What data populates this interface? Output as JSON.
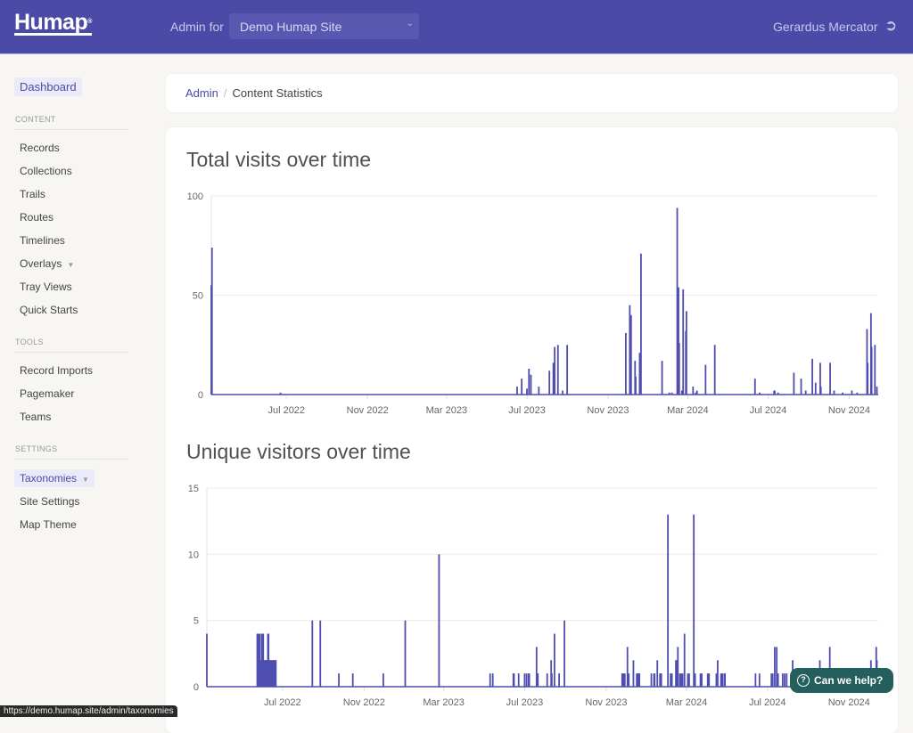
{
  "header": {
    "logo": "Humap",
    "admin_for": "Admin for",
    "site": "Demo Humap Site",
    "user": "Gerardus Mercator",
    "logout_icon": "sign-out-icon"
  },
  "sidebar": {
    "dashboard": "Dashboard",
    "sections": [
      {
        "title": "CONTENT",
        "items": [
          {
            "label": "Records"
          },
          {
            "label": "Collections"
          },
          {
            "label": "Trails"
          },
          {
            "label": "Routes"
          },
          {
            "label": "Timelines"
          },
          {
            "label": "Overlays",
            "caret": true
          },
          {
            "label": "Tray Views"
          },
          {
            "label": "Quick Starts"
          }
        ]
      },
      {
        "title": "TOOLS",
        "items": [
          {
            "label": "Record Imports"
          },
          {
            "label": "Pagemaker"
          },
          {
            "label": "Teams"
          }
        ]
      },
      {
        "title": "SETTINGS",
        "items": [
          {
            "label": "Taxonomies",
            "caret": true,
            "active": true
          },
          {
            "label": "Site Settings"
          },
          {
            "label": "Map Theme"
          }
        ]
      }
    ]
  },
  "breadcrumb": {
    "root": "Admin",
    "current": "Content Statistics"
  },
  "colors": {
    "brand": "#4b4aa7",
    "bar": "#4f4eb0",
    "help": "#245e5d"
  },
  "chart_data": [
    {
      "type": "bar",
      "title": "Total visits over time",
      "xlim": [
        "2022-03-09",
        "2024-12-15"
      ],
      "ylim": [
        0,
        100
      ],
      "yticks": [
        0,
        50,
        100
      ],
      "grid": true,
      "xticks": [
        {
          "date": "2022-07-01",
          "label": "Jul 2022"
        },
        {
          "date": "2022-11-01",
          "label": "Nov 2022"
        },
        {
          "date": "2023-03-01",
          "label": "Mar 2023"
        },
        {
          "date": "2023-07-01",
          "label": "Jul 2023"
        },
        {
          "date": "2023-11-01",
          "label": "Nov 2023"
        },
        {
          "date": "2024-03-01",
          "label": "Mar 2024"
        },
        {
          "date": "2024-07-01",
          "label": "Jul 2024"
        },
        {
          "date": "2024-11-01",
          "label": "Nov 2024"
        }
      ],
      "points": [
        [
          "2022-03-09",
          55
        ],
        [
          "2022-03-10",
          74
        ],
        [
          "2022-06-22",
          1
        ],
        [
          "2023-06-16",
          4
        ],
        [
          "2023-06-23",
          8
        ],
        [
          "2023-07-01",
          3
        ],
        [
          "2023-07-04",
          13
        ],
        [
          "2023-07-07",
          10
        ],
        [
          "2023-07-19",
          4
        ],
        [
          "2023-08-04",
          12
        ],
        [
          "2023-08-10",
          16
        ],
        [
          "2023-08-12",
          24
        ],
        [
          "2023-08-17",
          25
        ],
        [
          "2023-08-24",
          2
        ],
        [
          "2023-08-31",
          25
        ],
        [
          "2023-11-28",
          31
        ],
        [
          "2023-12-04",
          45
        ],
        [
          "2023-12-06",
          40
        ],
        [
          "2023-12-12",
          17
        ],
        [
          "2023-12-13",
          9
        ],
        [
          "2023-12-19",
          21
        ],
        [
          "2023-12-21",
          71
        ],
        [
          "2024-01-22",
          17
        ],
        [
          "2024-02-02",
          1
        ],
        [
          "2024-02-06",
          1
        ],
        [
          "2024-02-14",
          94
        ],
        [
          "2024-02-16",
          54
        ],
        [
          "2024-02-17",
          26
        ],
        [
          "2024-02-21",
          2
        ],
        [
          "2024-02-23",
          53
        ],
        [
          "2024-02-27",
          32
        ],
        [
          "2024-02-28",
          42
        ],
        [
          "2024-03-09",
          4
        ],
        [
          "2024-03-13",
          1
        ],
        [
          "2024-03-15",
          2
        ],
        [
          "2024-03-28",
          15
        ],
        [
          "2024-04-11",
          25
        ],
        [
          "2024-06-11",
          8
        ],
        [
          "2024-06-18",
          1
        ],
        [
          "2024-07-10",
          2
        ],
        [
          "2024-07-11",
          2
        ],
        [
          "2024-07-16",
          1
        ],
        [
          "2024-08-09",
          11
        ],
        [
          "2024-08-20",
          8
        ],
        [
          "2024-08-27",
          2
        ],
        [
          "2024-09-06",
          18
        ],
        [
          "2024-09-11",
          6
        ],
        [
          "2024-09-18",
          16
        ],
        [
          "2024-09-19",
          4
        ],
        [
          "2024-10-03",
          16
        ],
        [
          "2024-10-09",
          2
        ],
        [
          "2024-10-22",
          1
        ],
        [
          "2024-11-05",
          2
        ],
        [
          "2024-11-13",
          1
        ],
        [
          "2024-11-28",
          33
        ],
        [
          "2024-11-29",
          16
        ],
        [
          "2024-12-04",
          41
        ],
        [
          "2024-12-05",
          24
        ],
        [
          "2024-12-10",
          25
        ],
        [
          "2024-12-13",
          4
        ]
      ]
    },
    {
      "type": "bar",
      "title": "Unique visitors over time",
      "xlim": [
        "2022-03-09",
        "2024-12-15"
      ],
      "ylim": [
        0,
        15
      ],
      "yticks": [
        0,
        5,
        10,
        15
      ],
      "grid": true,
      "xticks": [
        {
          "date": "2022-07-01",
          "label": "Jul 2022"
        },
        {
          "date": "2022-11-01",
          "label": "Nov 2022"
        },
        {
          "date": "2023-03-01",
          "label": "Mar 2023"
        },
        {
          "date": "2023-07-01",
          "label": "Jul 2023"
        },
        {
          "date": "2023-11-01",
          "label": "Nov 2023"
        },
        {
          "date": "2024-03-01",
          "label": "Mar 2024"
        },
        {
          "date": "2024-07-01",
          "label": "Jul 2024"
        },
        {
          "date": "2024-11-01",
          "label": "Nov 2024"
        }
      ],
      "points": [
        [
          "2022-03-09",
          4
        ],
        [
          "2022-05-24",
          4
        ],
        [
          "2022-05-25",
          4
        ],
        [
          "2022-05-26",
          4
        ],
        [
          "2022-05-27",
          4
        ],
        [
          "2022-05-28",
          4
        ],
        [
          "2022-05-29",
          2
        ],
        [
          "2022-05-30",
          2
        ],
        [
          "2022-05-31",
          4
        ],
        [
          "2022-06-01",
          4
        ],
        [
          "2022-06-02",
          4
        ],
        [
          "2022-06-03",
          2
        ],
        [
          "2022-06-04",
          2
        ],
        [
          "2022-06-05",
          2
        ],
        [
          "2022-06-06",
          2
        ],
        [
          "2022-06-07",
          2
        ],
        [
          "2022-06-08",
          2
        ],
        [
          "2022-06-09",
          4
        ],
        [
          "2022-06-10",
          4
        ],
        [
          "2022-06-11",
          2
        ],
        [
          "2022-06-12",
          2
        ],
        [
          "2022-06-13",
          2
        ],
        [
          "2022-06-14",
          2
        ],
        [
          "2022-06-15",
          2
        ],
        [
          "2022-06-16",
          2
        ],
        [
          "2022-06-17",
          2
        ],
        [
          "2022-06-18",
          2
        ],
        [
          "2022-06-19",
          2
        ],
        [
          "2022-06-20",
          2
        ],
        [
          "2022-06-21",
          2
        ],
        [
          "2022-08-15",
          5
        ],
        [
          "2022-08-27",
          5
        ],
        [
          "2022-09-24",
          1
        ],
        [
          "2022-10-15",
          1
        ],
        [
          "2022-11-30",
          1
        ],
        [
          "2023-01-02",
          5
        ],
        [
          "2023-02-22",
          10
        ],
        [
          "2023-05-10",
          1
        ],
        [
          "2023-05-14",
          1
        ],
        [
          "2023-06-14",
          1
        ],
        [
          "2023-06-15",
          1
        ],
        [
          "2023-06-22",
          1
        ],
        [
          "2023-07-01",
          1
        ],
        [
          "2023-07-04",
          1
        ],
        [
          "2023-07-07",
          1
        ],
        [
          "2023-07-08",
          1
        ],
        [
          "2023-07-19",
          3
        ],
        [
          "2023-07-21",
          1
        ],
        [
          "2023-08-04",
          1
        ],
        [
          "2023-08-10",
          2
        ],
        [
          "2023-08-11",
          1
        ],
        [
          "2023-08-15",
          4
        ],
        [
          "2023-08-22",
          1
        ],
        [
          "2023-08-30",
          5
        ],
        [
          "2023-11-25",
          1
        ],
        [
          "2023-11-27",
          1
        ],
        [
          "2023-11-29",
          1
        ],
        [
          "2023-12-03",
          3
        ],
        [
          "2023-12-05",
          1
        ],
        [
          "2023-12-12",
          2
        ],
        [
          "2023-12-17",
          1
        ],
        [
          "2023-12-18",
          1
        ],
        [
          "2023-12-20",
          1
        ],
        [
          "2023-12-21",
          1
        ],
        [
          "2024-01-08",
          1
        ],
        [
          "2024-01-12",
          1
        ],
        [
          "2024-01-13",
          1
        ],
        [
          "2024-01-17",
          2
        ],
        [
          "2024-01-21",
          1
        ],
        [
          "2024-01-22",
          1
        ],
        [
          "2024-01-23",
          1
        ],
        [
          "2024-02-02",
          13
        ],
        [
          "2024-02-06",
          1
        ],
        [
          "2024-02-08",
          1
        ],
        [
          "2024-02-14",
          2
        ],
        [
          "2024-02-15",
          2
        ],
        [
          "2024-02-17",
          3
        ],
        [
          "2024-02-20",
          1
        ],
        [
          "2024-02-22",
          1
        ],
        [
          "2024-02-24",
          1
        ],
        [
          "2024-02-27",
          4
        ],
        [
          "2024-03-03",
          1
        ],
        [
          "2024-03-05",
          1
        ],
        [
          "2024-03-12",
          13
        ],
        [
          "2024-03-14",
          1
        ],
        [
          "2024-03-22",
          1
        ],
        [
          "2024-03-24",
          1
        ],
        [
          "2024-04-02",
          1
        ],
        [
          "2024-04-04",
          1
        ],
        [
          "2024-04-15",
          1
        ],
        [
          "2024-04-17",
          2
        ],
        [
          "2024-04-22",
          1
        ],
        [
          "2024-04-24",
          1
        ],
        [
          "2024-04-27",
          1
        ],
        [
          "2024-04-28",
          1
        ],
        [
          "2024-06-13",
          1
        ],
        [
          "2024-06-19",
          1
        ],
        [
          "2024-07-07",
          1
        ],
        [
          "2024-07-09",
          1
        ],
        [
          "2024-07-12",
          3
        ],
        [
          "2024-07-15",
          3
        ],
        [
          "2024-07-17",
          1
        ],
        [
          "2024-07-24",
          1
        ],
        [
          "2024-07-27",
          1
        ],
        [
          "2024-07-30",
          1
        ],
        [
          "2024-08-08",
          2
        ],
        [
          "2024-09-18",
          2
        ],
        [
          "2024-10-03",
          3
        ],
        [
          "2024-12-04",
          2
        ],
        [
          "2024-12-12",
          3
        ],
        [
          "2024-12-13",
          2
        ]
      ]
    }
  ],
  "status_url": "https://demo.humap.site/admin/taxonomies",
  "help": {
    "label": "Can we help?",
    "icon": "question-circle-icon"
  }
}
